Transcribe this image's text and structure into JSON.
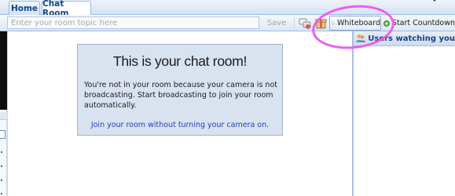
{
  "tabs": [
    {
      "label": "Home",
      "active": false
    },
    {
      "label": "Chat Room",
      "active": true
    }
  ],
  "toolbar": {
    "topic_placeholder": "Enter your room topic here",
    "save_label": "Save",
    "whiteboard_label": "Whiteboard",
    "countdown_label": "Start Countdown"
  },
  "message": {
    "title": "This is your chat room!",
    "body": "You're not in your room because your camera is not broadcasting. Start broadcasting to join your room automatically.",
    "link": "Join your room without turning your camera on."
  },
  "side_panel": {
    "title": "Users watching you"
  },
  "icons": {
    "corner": "diamond-icon",
    "toolbar_1": "chat-bubbles-icon",
    "toolbar_2": "gift-icon",
    "whiteboard": "whiteboard-icon",
    "countdown": "add-circle-icon",
    "side_panel": "users-icon"
  },
  "colors": {
    "accent": "#15428b",
    "link": "#1f3fc4",
    "highlight": "#f05cf0",
    "countdown_icon": "#5aa43a"
  }
}
